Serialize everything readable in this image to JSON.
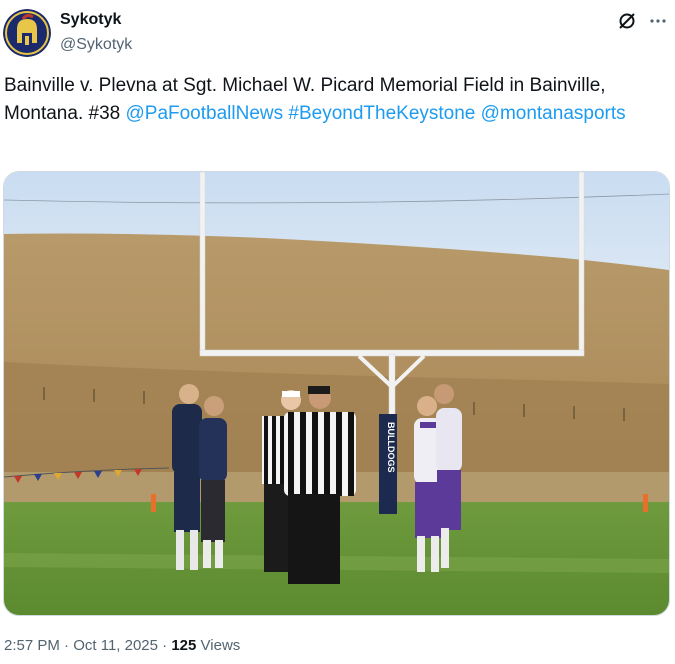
{
  "author": {
    "name": "Sykotyk",
    "handle": "@Sykotyk",
    "avatar_icon": "spartan-helmet-avatar",
    "avatar_colors": {
      "bg": "#1a2a6c",
      "ring": "#e8c64a"
    }
  },
  "header_icons": [
    "grok-icon",
    "more-icon"
  ],
  "tweet": {
    "text_plain": "Bainville v. Plevna at Sgt. Michael W. Picard Memorial Field in Bainville, Montana. #38",
    "mentions": [
      "@PaFootballNews",
      "#BeyondTheKeystone",
      "@montanasports"
    ]
  },
  "photo": {
    "scene_text": "BULLDOGS"
  },
  "meta": {
    "time": "2:57 PM",
    "separator": " · ",
    "date": "Oct 11, 2025",
    "views_count": "125",
    "views_label": " Views"
  },
  "colors": {
    "link": "#1d9bf0",
    "muted": "#536471",
    "text": "#0f1419"
  }
}
